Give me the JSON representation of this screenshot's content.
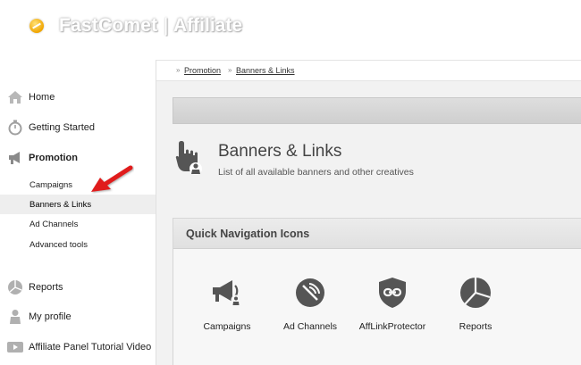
{
  "header": {
    "brand": "FastComet",
    "separator": "|",
    "product": "Affiliate"
  },
  "sidebar": {
    "items": [
      {
        "label": "Home",
        "icon": "home-icon"
      },
      {
        "label": "Getting Started",
        "icon": "stopwatch-icon"
      },
      {
        "label": "Promotion",
        "icon": "megaphone-icon"
      },
      {
        "label": "Reports",
        "icon": "pie-chart-icon"
      },
      {
        "label": "My profile",
        "icon": "user-icon"
      },
      {
        "label": "Affiliate Panel Tutorial Video",
        "icon": "video-icon"
      }
    ],
    "subitems": [
      {
        "label": "Campaigns"
      },
      {
        "label": "Banners & Links"
      },
      {
        "label": "Ad Channels"
      },
      {
        "label": "Advanced tools"
      }
    ]
  },
  "breadcrumb": {
    "sep": "»",
    "items": [
      {
        "label": "Promotion"
      },
      {
        "label": "Banners & Links"
      }
    ]
  },
  "page": {
    "title": "Banners & Links",
    "description": "List of all available banners and other creatives"
  },
  "quick_nav": {
    "title": "Quick Navigation Icons",
    "items": [
      {
        "label": "Campaigns",
        "icon": "megaphone-icon"
      },
      {
        "label": "Ad Channels",
        "icon": "satellite-dish-icon"
      },
      {
        "label": "AffLinkProtector",
        "icon": "shield-link-icon"
      },
      {
        "label": "Reports",
        "icon": "pie-chart-icon"
      }
    ]
  },
  "colors": {
    "accent_arrow": "#e01b1b",
    "icon_grey": "#555555",
    "selected_bg": "#eeeeee"
  }
}
